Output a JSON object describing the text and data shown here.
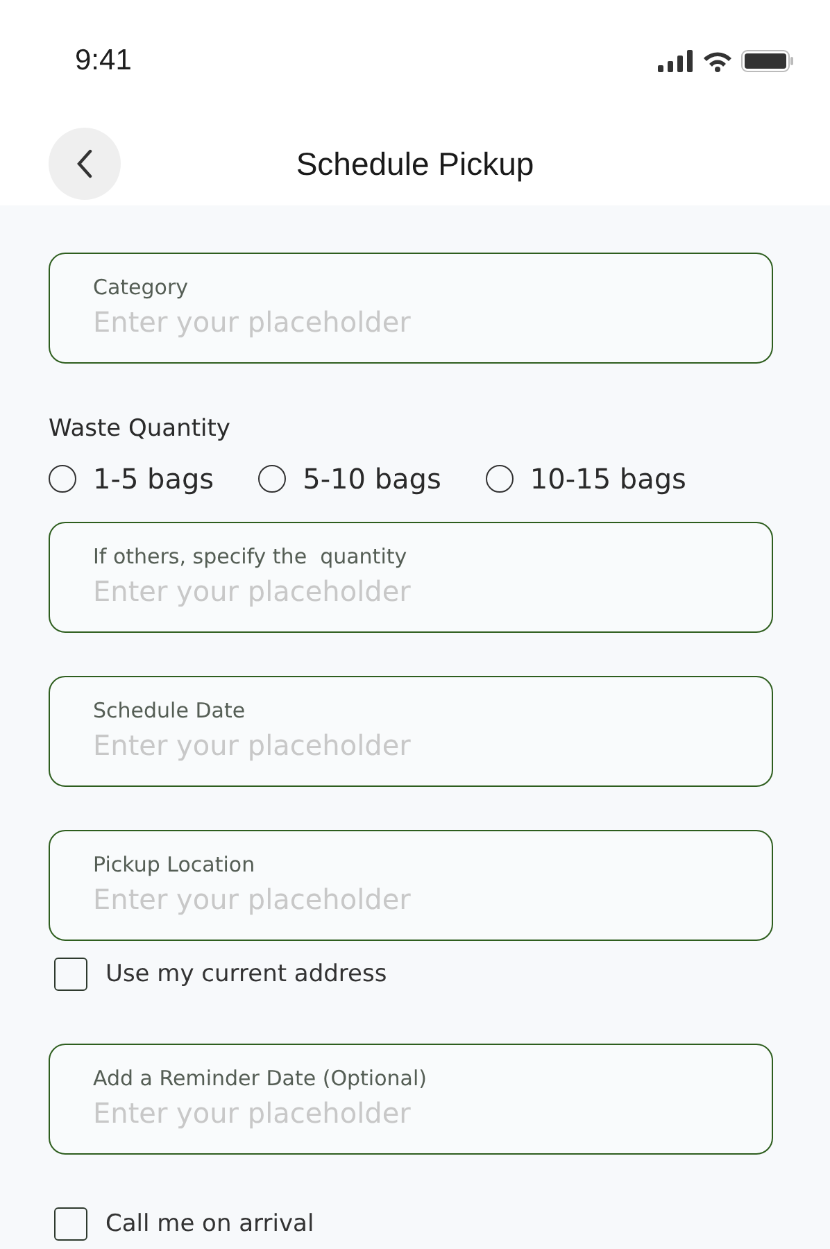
{
  "status_bar": {
    "time": "9:41"
  },
  "header": {
    "title": "Schedule Pickup"
  },
  "form": [
    {
      "kind": "field",
      "label": "Category",
      "placeholder": "Enter your placeholder"
    },
    {
      "kind": "heading",
      "text": "Waste Quantity"
    },
    {
      "kind": "radios",
      "options": [
        {
          "label": "1-5 bags",
          "selected": false
        },
        {
          "label": "5-10 bags",
          "selected": false
        },
        {
          "label": "10-15 bags",
          "selected": false
        }
      ]
    },
    {
      "kind": "field",
      "label": "If others, specify the  quantity",
      "placeholder": "Enter your placeholder"
    },
    {
      "kind": "field",
      "label": "Schedule Date",
      "placeholder": "Enter your placeholder"
    },
    {
      "kind": "field",
      "label": "Pickup Location",
      "placeholder": "Enter your placeholder"
    },
    {
      "kind": "checkbox",
      "label": "Use my current address",
      "checked": false
    },
    {
      "kind": "field",
      "label": "Add a Reminder Date (Optional)",
      "placeholder": "Enter your placeholder"
    },
    {
      "kind": "checkbox",
      "label": "Call me on arrival",
      "checked": false
    }
  ]
}
